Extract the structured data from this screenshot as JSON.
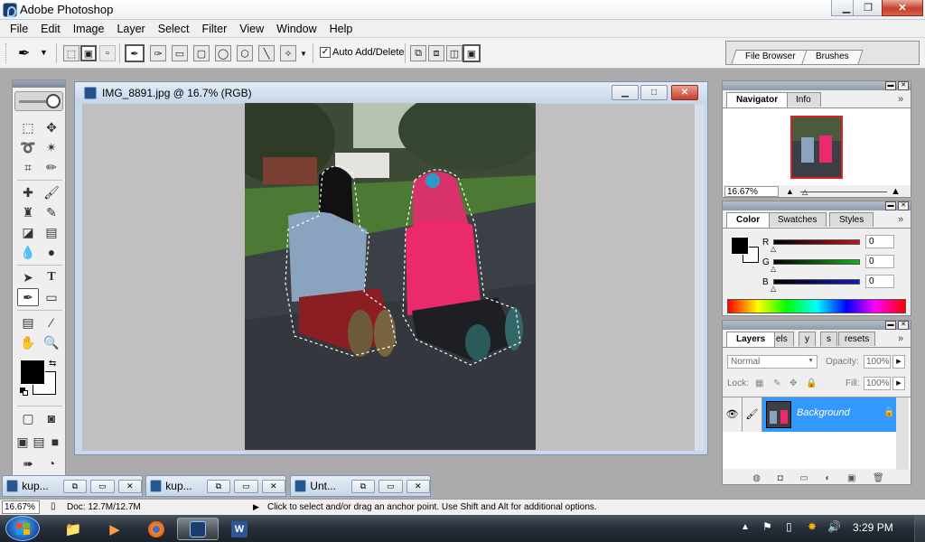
{
  "app": {
    "title": "Adobe Photoshop",
    "window_controls": {
      "minimize": "▁",
      "restore": "❐",
      "close": "✕"
    }
  },
  "menu": [
    "File",
    "Edit",
    "Image",
    "Layer",
    "Select",
    "Filter",
    "View",
    "Window",
    "Help"
  ],
  "options_bar": {
    "auto_add_delete_checked": true,
    "auto_add_delete_label": "Auto Add/Delete",
    "palette_well_tabs": [
      "File Browser",
      "Brushes"
    ]
  },
  "document": {
    "title": "IMG_8891.jpg @ 16.7% (RGB)"
  },
  "navigator": {
    "tabs": [
      "Navigator",
      "Info"
    ],
    "zoom": "16.67%"
  },
  "color": {
    "tabs": [
      "Color",
      "Swatches",
      "Styles"
    ],
    "channels": [
      {
        "label": "R",
        "value": "0",
        "color": "#c01818"
      },
      {
        "label": "G",
        "value": "0",
        "color": "#18b018"
      },
      {
        "label": "B",
        "value": "0",
        "color": "#1818c0"
      }
    ]
  },
  "layers": {
    "tabs": [
      "Layers",
      "els",
      "y",
      "s",
      "resets"
    ],
    "blend_mode": "Normal",
    "opacity_label": "Opacity:",
    "opacity": "100%",
    "lock_label": "Lock:",
    "fill_label": "Fill:",
    "fill": "100%",
    "layer_name": "Background"
  },
  "minimized_docs": [
    {
      "title": "kup..."
    },
    {
      "title": "kup..."
    },
    {
      "title": "Unt..."
    }
  ],
  "status": {
    "zoom": "16.67%",
    "doc_info": "Doc: 12.7M/12.7M",
    "hint": "Click to select and/or drag an anchor point.  Use Shift and Alt for additional options."
  },
  "taskbar": {
    "clock": "3:29 PM"
  }
}
